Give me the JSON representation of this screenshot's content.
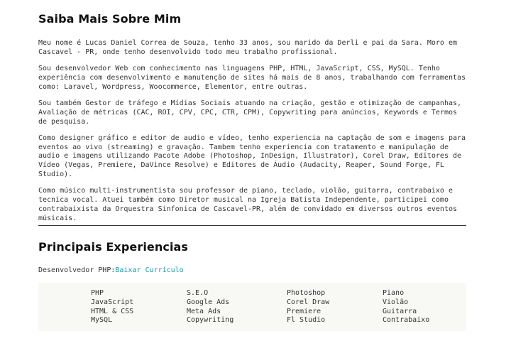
{
  "about": {
    "title": "Saiba Mais Sobre Mim",
    "paragraphs": [
      "Meu nome é Lucas Daniel Correa de Souza, tenho 33 anos, sou marido da Derli e pai da Sara. Moro em Cascavel - PR, onde tenho desenvolvido todo meu trabalho profissional.",
      "Sou desenvolvedor Web com conhecimento nas linguagens PHP, HTML, JavaScript, CSS, MySQL. Tenho experiência com desenvolvimento e manutenção de sites há mais de 8 anos, trabalhando com ferramentas como: Laravel, Wordpress, Woocommerce, Elementor, entre outras.",
      "Sou também Gestor de tráfego e Mídias Sociais atuando na criação, gestão e otimização de campanhas, Avaliação de métricas (CAC, ROI, CPV, CPC, CTR, CPM), Copywriting para anúncios, Keywords e Termos de pesquisa.",
      "Como designer gráfico e editor de audio e vídeo, tenho experiencia na captação de som e imagens para eventos ao vivo (streaming) e gravação. Tambem tenho experiencia com tratamento e manipulação de audio e imagens utilizando Pacote Adobe (Photoshop, InDesign, Illustrator), Corel Draw, Editores de Vídeo (Vegas, Premiere, DaVince Resolve) e Editores de Áudio (Audacity, Reaper, Sound Forge, FL Studio).",
      "Como músico multi-instrumentista sou professor de piano, teclado, violão, guitarra, contrabaixo e tecnica vocal. Atuei também como Diretor musical na Igreja Batista Independente, participei como contrabaixista da Orquestra Sinfonica de Cascavel-PR, além de convidado em diversos outros eventos músicais."
    ]
  },
  "experience": {
    "title": "Principais Experiencias",
    "role_label": "Desenvolvedor PHP:",
    "resume_link": "Baixar Currículo",
    "skill_columns": [
      [
        "PHP",
        "JavaScript",
        "HTML & CSS",
        "MySQL"
      ],
      [
        "S.E.O",
        "Google Ads",
        "Meta Ads",
        "Copywriting"
      ],
      [
        "Photoshop",
        "Corel Draw",
        "Premiere",
        "Fl Studio"
      ],
      [
        "Piano",
        "Violão",
        "Guitarra",
        "Contrabaixo"
      ]
    ]
  },
  "colors": {
    "link": "#1a9aa6",
    "skills_bg": "#f8f8f5",
    "divider": "#333333"
  }
}
